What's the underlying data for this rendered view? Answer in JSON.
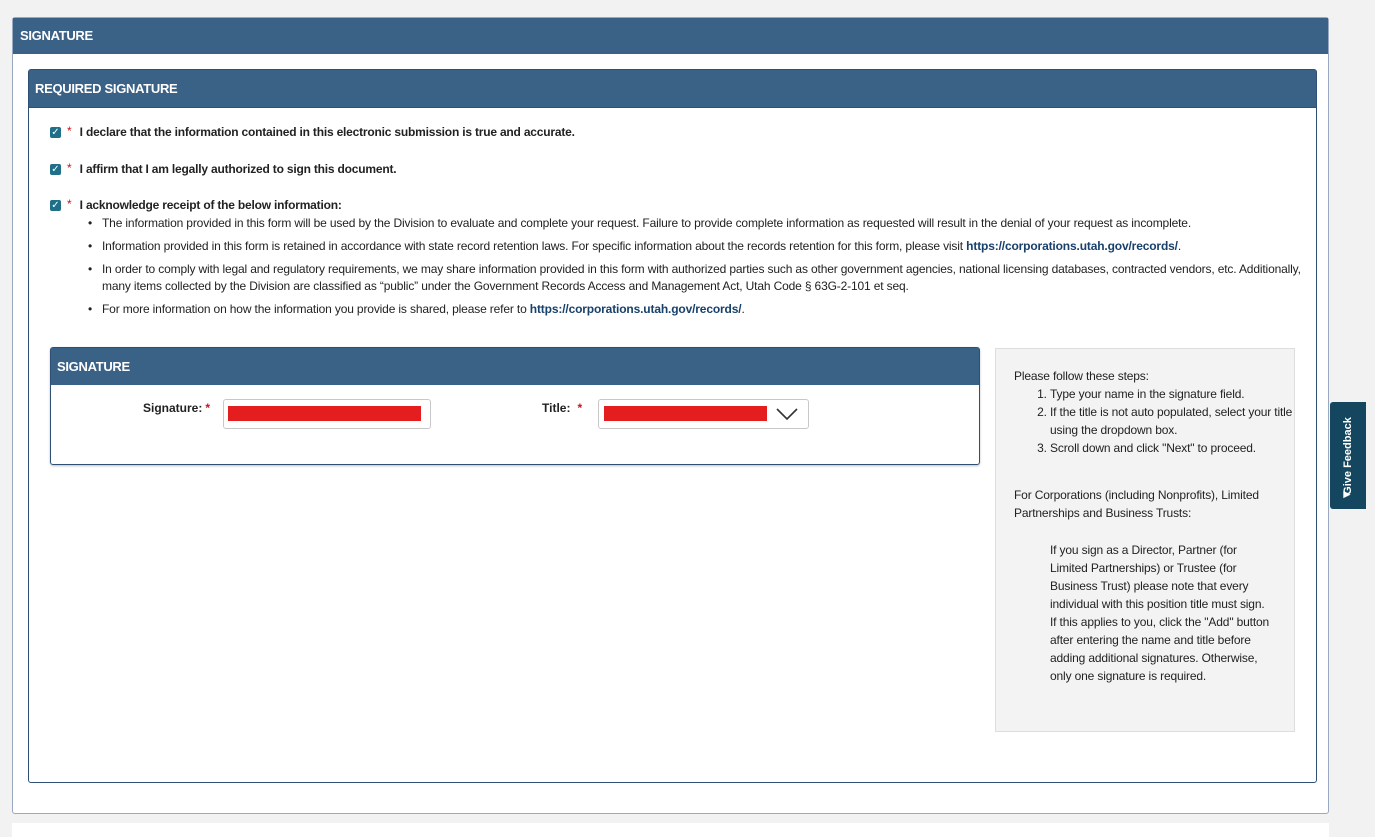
{
  "outer": {
    "title": "SIGNATURE"
  },
  "required": {
    "title": "REQUIRED SIGNATURE",
    "checks": [
      {
        "label": "I declare that the information contained in this electronic submission is true and accurate.",
        "checked": true
      },
      {
        "label": "I affirm that I am legally authorized to sign this document.",
        "checked": true
      },
      {
        "label": "I acknowledge receipt of the below information:",
        "checked": true
      }
    ],
    "required_marker": "*",
    "bullets": [
      {
        "text": "The information provided in this form will be used by the Division to evaluate and complete your request. Failure to provide complete information as requested will result in the denial of your request as incomplete."
      },
      {
        "text": "Information provided in this form is retained in accordance with state record retention laws. For specific information about the records retention for this form, please visit ",
        "link": "https://corporations.utah.gov/records/",
        "after": "."
      },
      {
        "text": "In order to comply with legal and regulatory requirements, we may share information provided in this form with authorized parties such as other government agencies, national licensing databases, contracted vendors, etc. Additionally, many items collected by the Division are classified as “public” under the Government Records Access and Management Act, Utah Code § 63G-2-101 et seq."
      },
      {
        "text": "For more information on how the information you provide is shared, please refer to ",
        "link": "https://corporations.utah.gov/records/",
        "after": "."
      }
    ]
  },
  "signature": {
    "title": "SIGNATURE",
    "signature_label": "Signature:",
    "title_label": "Title:",
    "required_marker": "*"
  },
  "help": {
    "intro": "Please follow these steps:",
    "steps": [
      "Type your name in the signature field.",
      "If the title is not auto populated, select your title using the dropdown box.",
      "Scroll down and click \"Next\" to proceed."
    ],
    "corp_heading": "For Corporations (including Nonprofits), Limited Partnerships and Business Trusts:",
    "corp_note": "If you sign as a Director, Partner (for Limited Partnerships) or Trustee (for Business Trust) please note that every individual with this position title must sign. If this applies to you, click the \"Add\" button after entering the name and title before adding additional signatures. Otherwise, only one signature is required."
  },
  "feedback": {
    "label": "Give Feedback",
    "icon": "megaphone-icon"
  },
  "colors": {
    "header": "#3a6186",
    "required": "#d0101b",
    "checkbox": "#1f6f89",
    "feedback": "#14475f",
    "redaction": "#e41e1e"
  }
}
